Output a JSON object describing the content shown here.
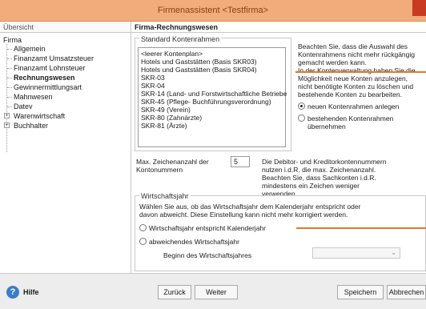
{
  "window": {
    "title": "Firmenassistent <Testfirma>"
  },
  "overview": {
    "label": "Übersicht"
  },
  "page": {
    "title": "Firma-Rechnungswesen"
  },
  "tree": {
    "root": "Firma",
    "items": [
      "Allgemein",
      "Finanzamt Umsatzsteuer",
      "Finanzamt Lohnsteuer",
      "Rechnungswesen",
      "Gewinnermittlungsart",
      "Mahnwesen",
      "Datev",
      "Warenwirtschaft",
      "Buchhalter"
    ],
    "selected": "Rechnungswesen"
  },
  "kontenrahmen": {
    "label": "Standard Kontenrahmen",
    "items": [
      "<leerer Kontenplan>",
      "Hotels und Gaststätten (Basis SKR03)",
      "Hotels und Gaststätten (Basis SKR04)",
      "SKR-03",
      "SKR-04",
      "SKR-14 (Land- und Forstwirtschaftliche Betriebe",
      "SKR-45 (Pflege- Buchführungsverordnung)",
      "SKR-49 (Verein)",
      "SKR-80 (Zahnärzte)",
      "SKR-81 (Ärzte)"
    ],
    "note": [
      "Beachten Sie, dass die Auswahl des",
      "Kontenrahmens nicht mehr rückgängig",
      "gemacht werden kann.",
      "In der Kontenverwaltung haben Sie die",
      "Möglichkeit neue Konten anzulegen,",
      "nicht benötigte Konten zu löschen und",
      "bestehende Konten zu bearbeiten."
    ],
    "radio_new": "neuen Kontenrahmen anlegen",
    "radio_existing": [
      "bestehenden Kontenrahmen",
      "übernehmen"
    ]
  },
  "zeichen": {
    "label": [
      "Max. Zeichenanzahl der",
      "Kontonummern"
    ],
    "value": "5",
    "note": [
      "Die Debitor- und Kreditorkontennummern",
      "nutzen i.d.R. die max. Zeichenanzahl.",
      "Beachten Sie, dass Sachkonten i.d.R.",
      "mindestens ein Zeichen weniger",
      "verwenden"
    ]
  },
  "wj": {
    "label": "Wirtschaftsjahr",
    "desc": [
      "Wählen Sie aus, ob das Wirtschaftsjahr dem Kalenderjahr entspricht oder",
      "davon abweicht. Diese Einstellung kann nicht mehr korrigiert werden."
    ],
    "radio1": "Wirtschaftsjahr entspricht Kalenderjahr",
    "radio2": "abweichendes Wirtschaftsjahr",
    "begin_label": "Beginn des Wirtschaftsjahres"
  },
  "footer": {
    "help": "Hilfe",
    "back": "Zurück",
    "next": "Weiter",
    "save": "Speichern",
    "cancel": "Abbrechen"
  },
  "colors": {
    "titlebar": "#f2ac7c",
    "accent_line": "#e07a2a",
    "close": "#c93a22",
    "help": "#3a7dc9"
  }
}
